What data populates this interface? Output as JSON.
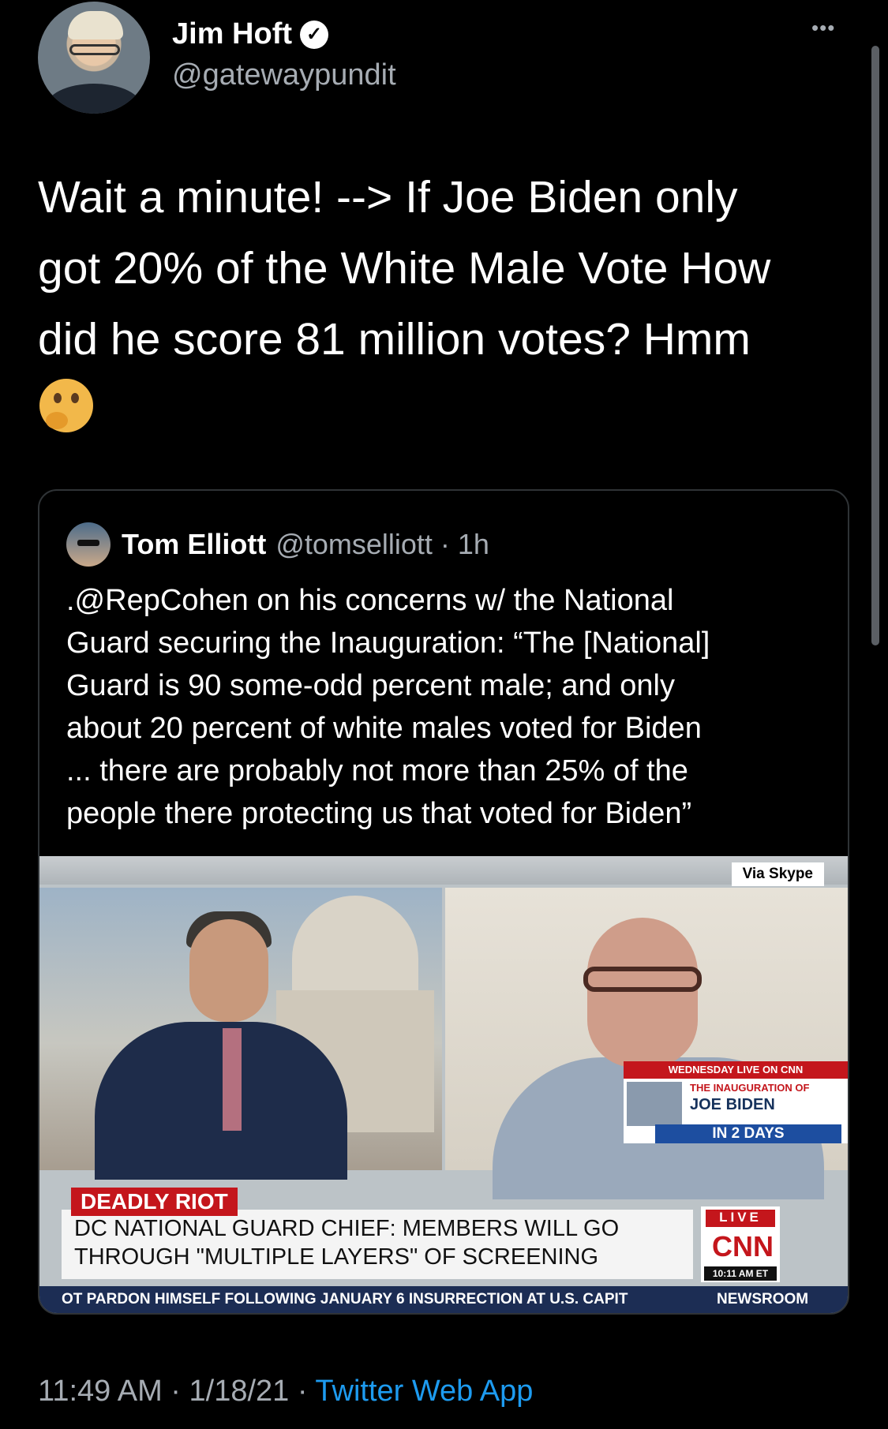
{
  "tweet": {
    "author_name": "Jim Hoft",
    "author_handle": "@gatewaypundit",
    "verified_icon": "✓",
    "more_icon": "•••",
    "text": "Wait a minute! --> If Joe Biden only\ngot 20% of the White Male Vote How\ndid he score 81 million votes? Hmm",
    "emoji": "thinking-face",
    "time": "11:49 AM",
    "date": "1/18/21",
    "source": "Twitter Web App",
    "separator": "·"
  },
  "quoted": {
    "author_name": "Tom Elliott",
    "author_handle": "@tomselliott · 1h",
    "text": ".@RepCohen on his concerns w/ the National\nGuard securing the Inauguration: “The [National]\nGuard is 90 some-odd percent male; and only\nabout 20 percent of white males voted for Biden\n... there are probably not more than 25% of the\npeople there protecting us that voted for Biden”"
  },
  "video": {
    "via": "Via Skype",
    "promo_top": "WEDNESDAY LIVE ON CNN",
    "promo_t1": "THE INAUGURATION OF",
    "promo_t2": "JOE BIDEN",
    "promo_t3": "IN 2 DAYS",
    "tag": "DEADLY RIOT",
    "headline": "DC NATIONAL GUARD CHIEF: MEMBERS WILL GO\nTHROUGH \"MULTIPLE LAYERS\" OF SCREENING",
    "live": "LIVE",
    "network": "CNN",
    "clock": "10:11 AM ET",
    "ticker": "OT PARDON HIMSELF FOLLOWING JANUARY 6 INSURRECTION AT U.S. CAPIT",
    "ticker_show": "NEWSROOM"
  },
  "colors": {
    "background": "#000000",
    "link": "#1d9bf0",
    "cnn_red": "#c4161c"
  }
}
